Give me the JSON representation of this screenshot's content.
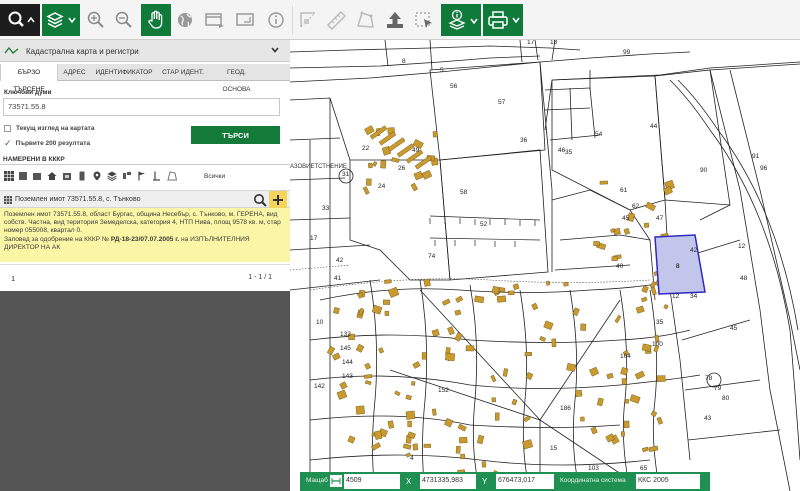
{
  "toolbar": {
    "buttons": [
      {
        "name": "search-tool",
        "icon": "search-icon"
      },
      {
        "name": "layers-tool",
        "icon": "layers-icon"
      },
      {
        "name": "zoom-in-tool",
        "icon": "zoom-in-icon"
      },
      {
        "name": "zoom-out-tool",
        "icon": "zoom-out-icon"
      },
      {
        "name": "pan-tool",
        "icon": "hand-icon"
      },
      {
        "name": "globe-tool",
        "icon": "globe-icon"
      },
      {
        "name": "window-tool",
        "icon": "window-icon"
      },
      {
        "name": "resize-tool",
        "icon": "resize-icon"
      },
      {
        "name": "info-tool",
        "icon": "info-icon"
      },
      {
        "name": "measure-area-tool",
        "icon": "measure-area-icon"
      },
      {
        "name": "ruler-tool",
        "icon": "ruler-icon"
      },
      {
        "name": "polygon-tool",
        "icon": "polygon-icon"
      },
      {
        "name": "upload-tool",
        "icon": "upload-icon"
      },
      {
        "name": "select-tool",
        "icon": "select-icon"
      },
      {
        "name": "info-layers-tool",
        "icon": "info-layers-icon"
      },
      {
        "name": "print-tool",
        "icon": "print-icon"
      }
    ],
    "colors": {
      "active": "#0f7a3a",
      "dark": "#1c1c1c"
    }
  },
  "panel": {
    "layer_title": "Кадастрална карта и регистри",
    "tabs": [
      "БЪРЗО ТЪРСЕНЕ",
      "АДРЕС",
      "ИДЕНТИФИКАТОР",
      "СТАР ИДЕНТ.",
      "ГЕОД. ОСНОВА"
    ],
    "keywords_label": "Ключови думи",
    "keywords_value": "73571.55.8",
    "current_view_label": "Текущ изглед на картата",
    "first_200_label": "Първите 200 резултата",
    "search_button": "ТЪРСИ",
    "found_title": "НАМЕРЕНИ В КККР",
    "filter_all": "Всички",
    "result_title": "Поземлен имот 73571.55.8, с. Тънково",
    "result_desc_1": "Поземлен имот 73571.55.8, област Бургас, община Несебър, с. Тънково, м. ГЕРЕНА, вид собств. Частна, вид територия Земеделска, категория 4, НТП Нива, площ 9578 кв. м, стар номер 055008, квартал 0.",
    "result_desc_2a": "Заповед за одобрение на КККР №",
    "result_desc_2b": "РД-18-23/07.07.2005 г.",
    "result_desc_2c": "на ИЗПЪЛНИТЕЛНИЯ ДИРЕКТОР НА АК",
    "page": "1",
    "page_count": "1 - 1 / 1"
  },
  "map": {
    "map_text": "АЗОВИЕТСТНЕНИЕ",
    "parcel_labels": [
      "17",
      "18",
      "8",
      "99",
      "5",
      "44",
      "90",
      "91",
      "96",
      "56",
      "57",
      "36",
      "58",
      "52",
      "33",
      "24",
      "26",
      "22",
      "49",
      "31",
      "42",
      "41",
      "74",
      "35",
      "47",
      "8",
      "40",
      "42",
      "12",
      "61",
      "62",
      "45",
      "46",
      "48",
      "12",
      "34",
      "35",
      "100",
      "10",
      "132",
      "145",
      "144",
      "143",
      "142",
      "186",
      "152",
      "103",
      "104",
      "303",
      "565",
      "28",
      "4",
      "15",
      "65",
      "17",
      "45",
      "43",
      "54",
      "78",
      "79",
      "80"
    ],
    "highlight_color": "#c2c6ea",
    "highlight_label": "8"
  },
  "statusbar": {
    "scale_label": "Мащаб",
    "scale_value": "4509",
    "x_label": "X",
    "x_value": "4731335,983",
    "y_label": "Y",
    "y_value": "676473,017",
    "crs_label": "Координатна система",
    "crs_value": "ККС 2005"
  }
}
